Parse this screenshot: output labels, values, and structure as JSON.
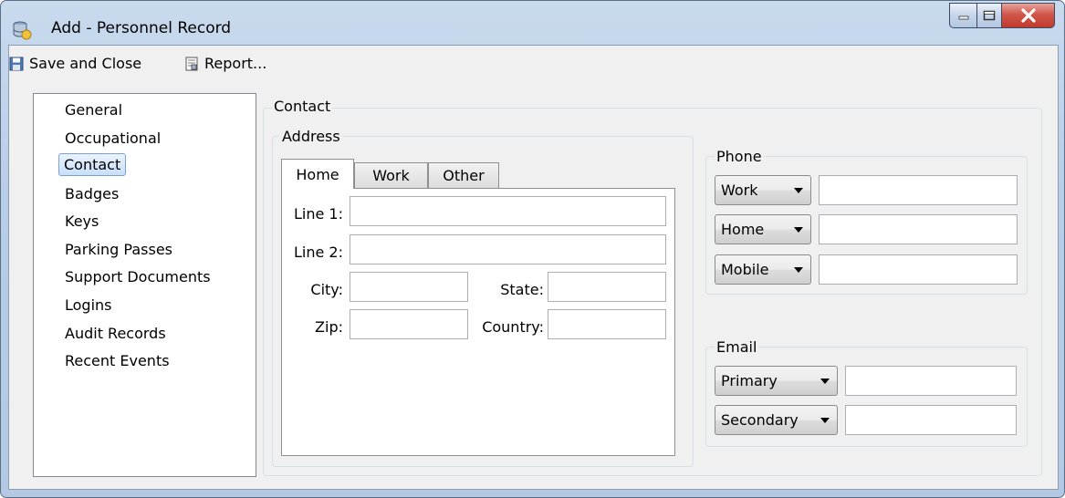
{
  "window": {
    "title": "Add - Personnel Record"
  },
  "toolbar": {
    "save_close": "Save and Close",
    "report": "Report..."
  },
  "nav": {
    "items": [
      "General",
      "Occupational",
      "Contact",
      "Badges",
      "Keys",
      "Parking Passes",
      "Support Documents",
      "Logins",
      "Audit Records",
      "Recent Events"
    ],
    "selected": "Contact"
  },
  "contact": {
    "group_label": "Contact",
    "address": {
      "group_label": "Address",
      "tabs": [
        "Home",
        "Work",
        "Other"
      ],
      "active_tab": "Home",
      "line1_label": "Line 1:",
      "line1_value": "",
      "line2_label": "Line 2:",
      "line2_value": "",
      "city_label": "City:",
      "city_value": "",
      "state_label": "State:",
      "state_value": "",
      "zip_label": "Zip:",
      "zip_value": "",
      "country_label": "Country:",
      "country_value": ""
    },
    "phone": {
      "group_label": "Phone",
      "rows": [
        {
          "type": "Work",
          "value": ""
        },
        {
          "type": "Home",
          "value": ""
        },
        {
          "type": "Mobile",
          "value": ""
        }
      ]
    },
    "email": {
      "group_label": "Email",
      "rows": [
        {
          "type": "Primary",
          "value": ""
        },
        {
          "type": "Secondary",
          "value": ""
        }
      ]
    }
  },
  "colors": {
    "selection": "#c7dffa",
    "close_button": "#c03a2c",
    "frame": "#b8cde6"
  }
}
